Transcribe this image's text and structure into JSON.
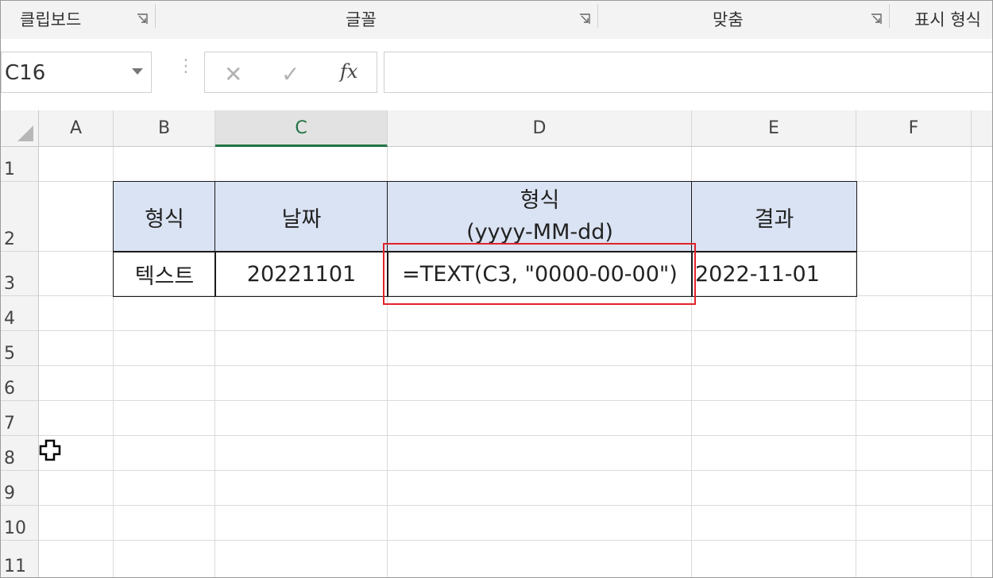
{
  "ribbon": {
    "groups": [
      {
        "label": "클립보드"
      },
      {
        "label": "글꼴"
      },
      {
        "label": "맞춤"
      },
      {
        "label": "표시 형식"
      }
    ]
  },
  "formula_bar": {
    "name_box": "C16",
    "cancel_icon": "✕",
    "enter_icon": "✓",
    "fx_label": "fx",
    "formula": ""
  },
  "columns": [
    "A",
    "B",
    "C",
    "D",
    "E",
    "F"
  ],
  "active_column": "C",
  "rows": [
    "1",
    "2",
    "3",
    "4",
    "5",
    "6",
    "7",
    "8",
    "9",
    "10",
    "11"
  ],
  "table": {
    "headers": {
      "format": "형식",
      "date": "날짜",
      "pattern_line1": "형식",
      "pattern_line2": "(yyyy-MM-dd)",
      "result": "결과"
    },
    "row": {
      "format": "텍스트",
      "date": "20221101",
      "formula": "=TEXT(C3, \"0000-00-00\")",
      "result": "2022-11-01"
    }
  },
  "colors": {
    "header_fill": "#dae3f3",
    "highlight_border": "#e2232a",
    "active_accent": "#217346"
  }
}
